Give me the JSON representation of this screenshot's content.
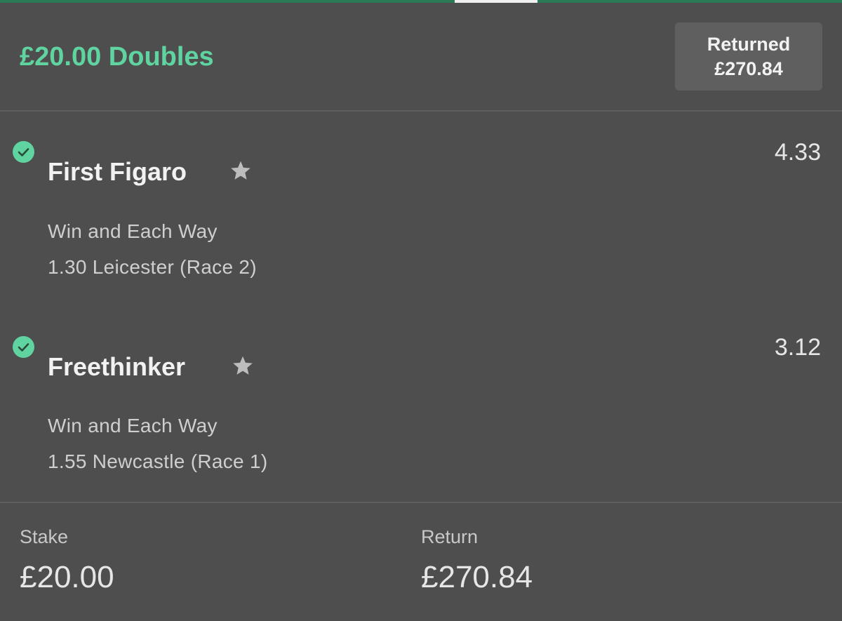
{
  "bet": {
    "title": "£20.00 Doubles",
    "returned_label": "Returned",
    "returned_amount": "£270.84"
  },
  "selections": [
    {
      "name": "First Figaro",
      "odds": "4.33",
      "market": "Win and Each Way",
      "event": "1.30 Leicester (Race 2)",
      "status": "won"
    },
    {
      "name": "Freethinker",
      "odds": "3.12",
      "market": "Win and Each Way",
      "event": "1.55 Newcastle (Race 1)",
      "status": "won"
    }
  ],
  "footer": {
    "stake_label": "Stake",
    "stake_value": "£20.00",
    "return_label": "Return",
    "return_value": "£270.84"
  },
  "colors": {
    "background": "#4e4e4e",
    "accent_green": "#5fd4a0",
    "returned_box": "#5f5f5f",
    "star": "#bdbdbd"
  },
  "icons": {
    "status": "check-circle-icon",
    "favourite": "star-icon"
  }
}
